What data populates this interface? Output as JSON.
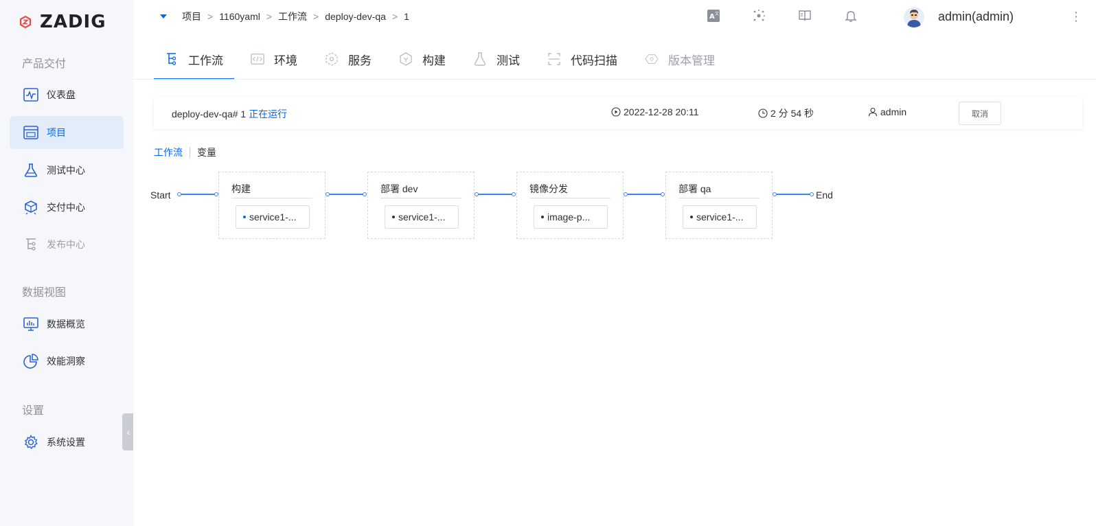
{
  "brand": {
    "name": "ZADIG"
  },
  "sidebar": {
    "sections": [
      {
        "title": "产品交付"
      },
      {
        "title": "数据视图"
      },
      {
        "title": "设置"
      }
    ],
    "items": [
      {
        "label": "仪表盘",
        "icon": "dashboard-icon"
      },
      {
        "label": "项目",
        "icon": "project-icon",
        "active": true
      },
      {
        "label": "测试中心",
        "icon": "flask-icon"
      },
      {
        "label": "交付中心",
        "icon": "delivery-icon"
      },
      {
        "label": "发布中心",
        "icon": "release-icon",
        "disabled": true
      },
      {
        "label": "数据概览",
        "icon": "chart-monitor-icon"
      },
      {
        "label": "效能洞察",
        "icon": "pie-chart-icon"
      },
      {
        "label": "系统设置",
        "icon": "gear-icon"
      }
    ],
    "collapse_glyph": "‹"
  },
  "breadcrumb": [
    "项目",
    "1160yaml",
    "工作流",
    "deploy-dev-qa",
    "1"
  ],
  "breadcrumb_sep": ">",
  "user": {
    "name": "admin(admin)"
  },
  "kebab_glyph": "⋮",
  "tabs": [
    {
      "label": "工作流",
      "icon": "workflow-icon",
      "active": true
    },
    {
      "label": "环境",
      "icon": "environment-icon"
    },
    {
      "label": "服务",
      "icon": "service-icon"
    },
    {
      "label": "构建",
      "icon": "build-icon"
    },
    {
      "label": "测试",
      "icon": "test-icon"
    },
    {
      "label": "代码扫描",
      "icon": "scan-icon"
    },
    {
      "label": "版本管理",
      "icon": "version-icon",
      "disabled": true
    }
  ],
  "run": {
    "title": "deploy-dev-qa# 1",
    "status": "正在运行",
    "start_time": "2022-12-28 20:11",
    "duration": "2 分 54 秒",
    "creator": "admin",
    "cancel_label": "取消"
  },
  "subtabs": {
    "workflow": "工作流",
    "variables": "变量"
  },
  "pipeline": {
    "start_label": "Start",
    "end_label": "End",
    "stages": [
      {
        "title": "构建",
        "job": "service1-...",
        "running": true
      },
      {
        "title": "部署 dev",
        "job": "service1-...",
        "running": false
      },
      {
        "title": "镜像分发",
        "job": "image-p...",
        "running": false
      },
      {
        "title": "部署 qa",
        "job": "service1-...",
        "running": false
      }
    ]
  },
  "colors": {
    "accent": "#0066ff",
    "connector": "#3b82f6",
    "sidebar_bg": "#f5f7fa",
    "active_bg": "#e3ecfb"
  }
}
